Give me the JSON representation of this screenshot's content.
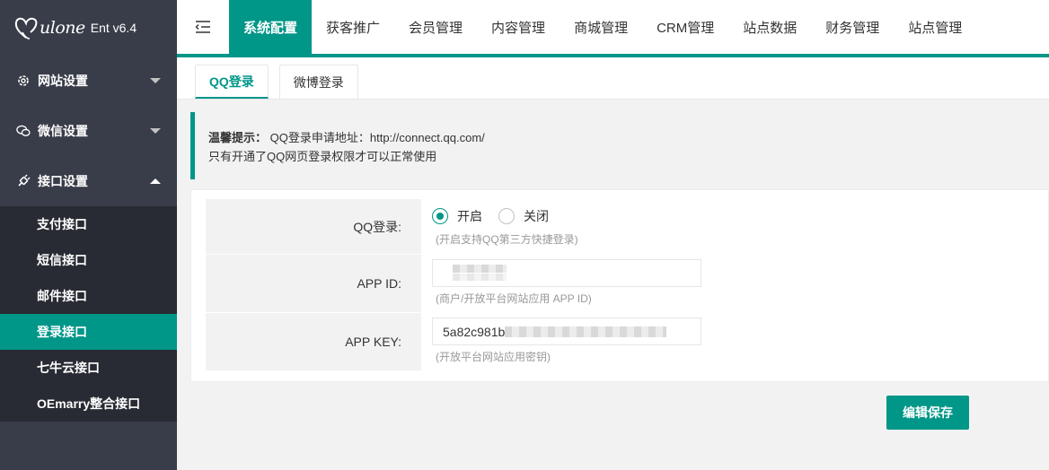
{
  "brand": {
    "script": "ulone",
    "version": "Ent v6.4",
    "logo_icon": "heart-icon"
  },
  "sidebar": {
    "groups": [
      {
        "label": "网站设置",
        "icon": "gear-icon",
        "state": "collapsed"
      },
      {
        "label": "微信设置",
        "icon": "chat-icon",
        "state": "collapsed"
      },
      {
        "label": "接口设置",
        "icon": "plug-icon",
        "state": "expanded"
      }
    ],
    "subitems": [
      {
        "label": "支付接口"
      },
      {
        "label": "短信接口"
      },
      {
        "label": "邮件接口"
      },
      {
        "label": "登录接口",
        "active": true
      },
      {
        "label": "七牛云接口"
      },
      {
        "label": "OEmarry整合接口"
      }
    ]
  },
  "topnav": {
    "toggle_icon": "menu-collapse-icon",
    "tabs": [
      {
        "label": "系统配置",
        "active": true
      },
      {
        "label": "获客推广"
      },
      {
        "label": "会员管理"
      },
      {
        "label": "内容管理"
      },
      {
        "label": "商城管理"
      },
      {
        "label": "CRM管理"
      },
      {
        "label": "站点数据"
      },
      {
        "label": "财务管理"
      },
      {
        "label": "站点管理"
      }
    ]
  },
  "subtabs": [
    {
      "label": "QQ登录",
      "active": true
    },
    {
      "label": "微博登录"
    }
  ],
  "tip": {
    "title": "温馨提示：",
    "line1": "QQ登录申请地址：http://connect.qq.com/",
    "line2": "只有开通了QQ网页登录权限才可以正常使用"
  },
  "form": {
    "qq_login": {
      "label": "QQ登录:",
      "options": [
        {
          "label": "开启",
          "checked": true
        },
        {
          "label": "关闭",
          "checked": false
        }
      ],
      "hint": "(开启支持QQ第三方快捷登录)"
    },
    "app_id": {
      "label": "APP ID:",
      "value": "",
      "hint": "(商户/开放平台网站应用 APP ID)"
    },
    "app_key": {
      "label": "APP KEY:",
      "value": "5a82c981b",
      "hint": "(开放平台网站应用密钥)"
    }
  },
  "actions": {
    "save_label": "编辑保存"
  },
  "colors": {
    "accent": "#009688",
    "sidebar_bg": "#393d49",
    "subnav_bg": "#282b33"
  }
}
